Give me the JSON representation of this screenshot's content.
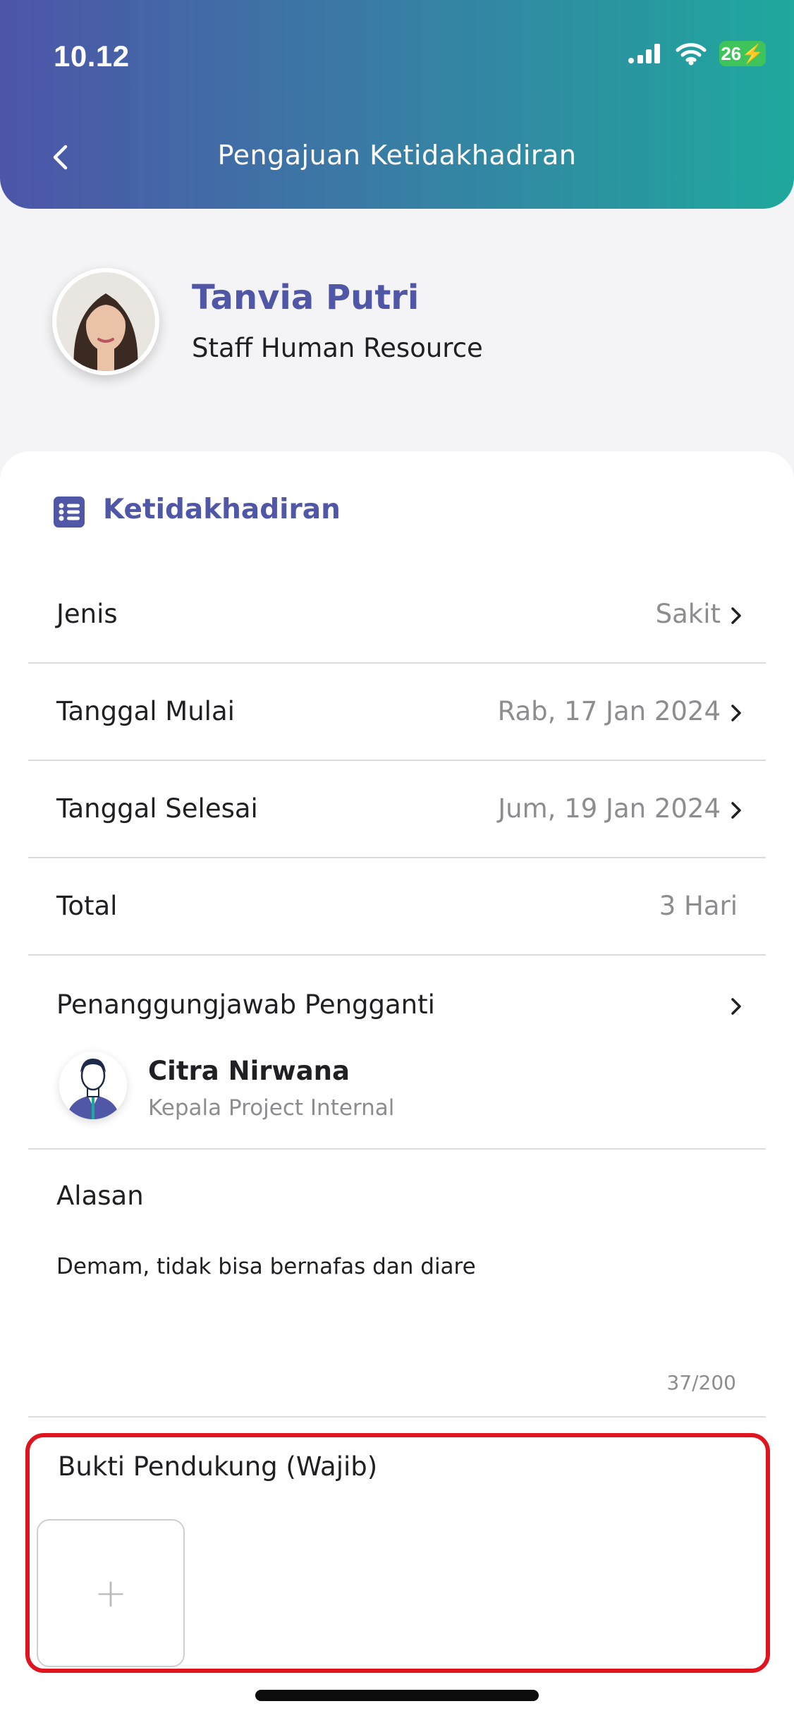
{
  "status_bar": {
    "time": "10.12",
    "battery": "26"
  },
  "header": {
    "title": "Pengajuan Ketidakhadiran"
  },
  "profile": {
    "name": "Tanvia Putri",
    "role": "Staff Human Resource"
  },
  "section": {
    "title": "Ketidakhadiran"
  },
  "fields": {
    "type": {
      "label": "Jenis",
      "value": "Sakit"
    },
    "start_date": {
      "label": "Tanggal Mulai",
      "value": "Rab, 17 Jan 2024"
    },
    "end_date": {
      "label": "Tanggal Selesai",
      "value": "Jum, 19 Jan 2024"
    },
    "total": {
      "label": "Total",
      "value": "3 Hari"
    },
    "substitute": {
      "label": "Penanggungjawab Pengganti",
      "name": "Citra Nirwana",
      "role": "Kepala Project Internal"
    },
    "reason": {
      "label": "Alasan",
      "value": "Demam, tidak bisa bernafas dan diare",
      "counter": "37/200"
    },
    "evidence": {
      "label": "Bukti Pendukung (Wajib)",
      "add_symbol": "+"
    }
  },
  "colors": {
    "accent": "#4f57a6",
    "highlight": "#e0141e",
    "gradient_start": "#4d55a8",
    "gradient_end": "#1fa89d"
  }
}
